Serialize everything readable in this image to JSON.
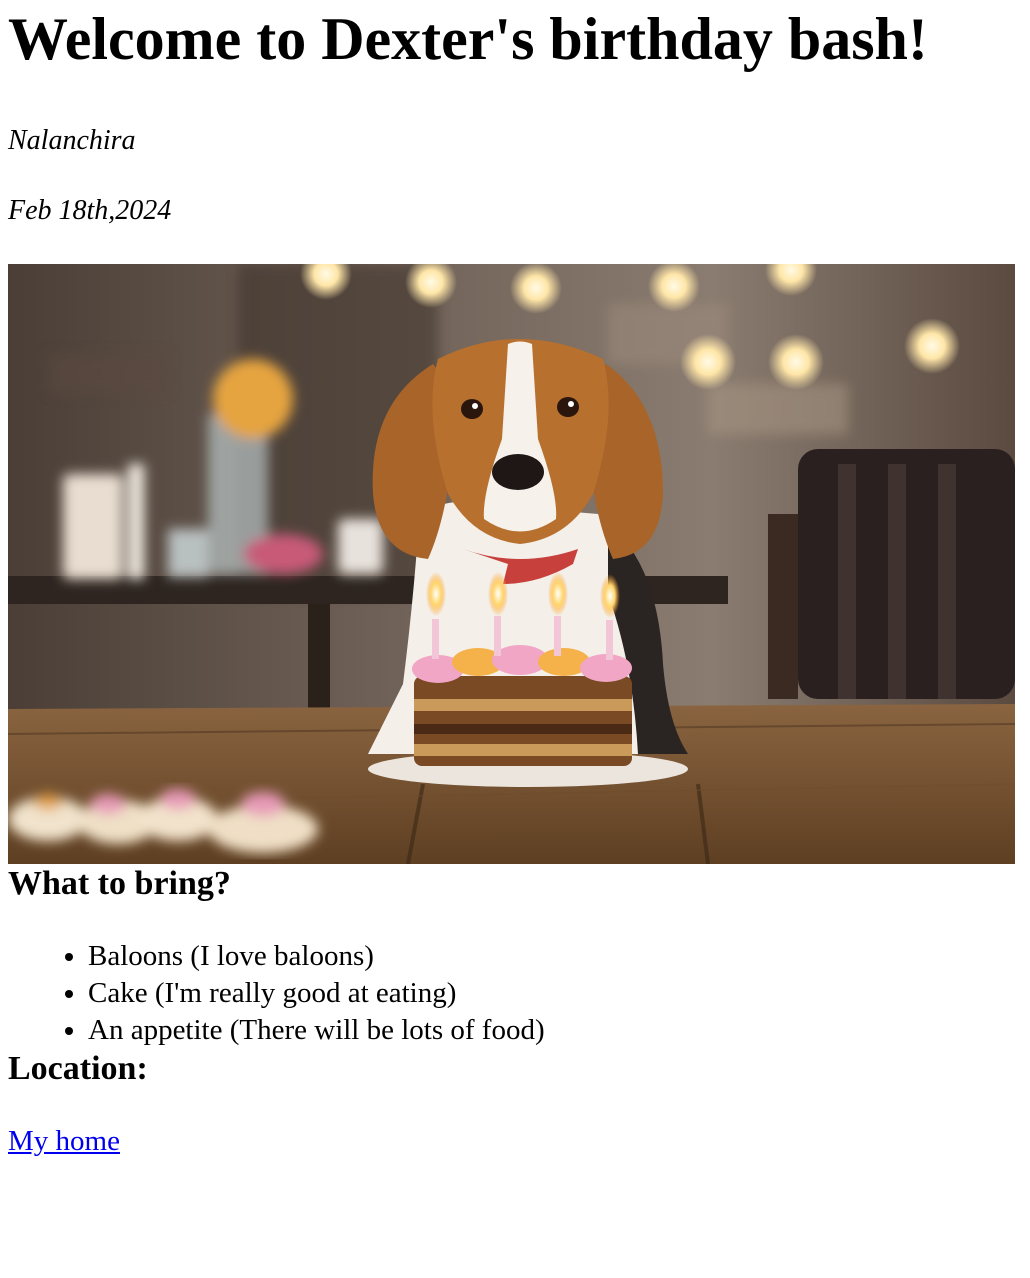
{
  "page": {
    "title": "Welcome to Dexter's birthday bash!",
    "place": "Nalanchira",
    "date": "Feb 18th,2024"
  },
  "hero_image": {
    "subject": "beagle with birthday cake and lit candles"
  },
  "bring": {
    "heading": "What to bring?",
    "items": [
      "Baloons (I love baloons)",
      "Cake (I'm really good at eating)",
      "An appetite (There will be lots of food)"
    ]
  },
  "location": {
    "heading": "Location:",
    "link_text": "My home"
  },
  "colors": {
    "link": "#0000ee",
    "text": "#000000",
    "background": "#ffffff"
  }
}
